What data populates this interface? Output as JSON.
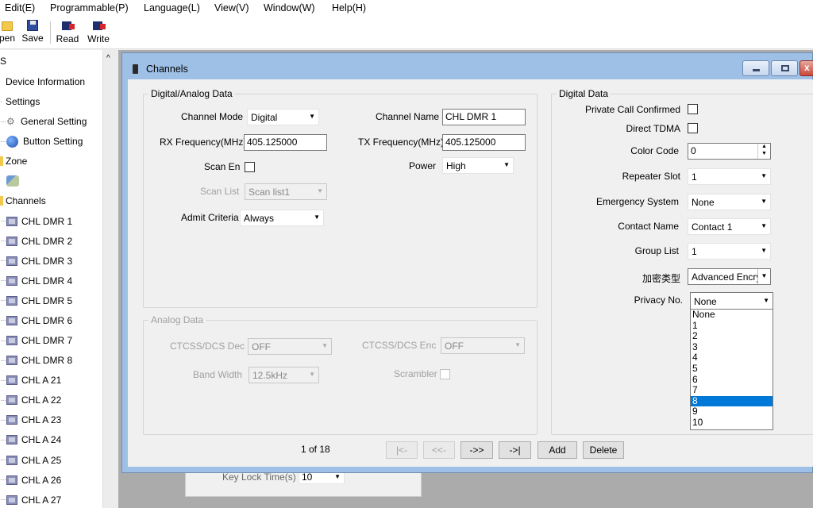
{
  "menu": {
    "items": [
      "Edit(E)",
      "Programmable(P)",
      "Language(L)",
      "View(V)",
      "Window(W)",
      "Help(H)"
    ]
  },
  "toolbar": {
    "open_label": "pen",
    "save_label": "Save",
    "read_label": "Read",
    "write_label": "Write"
  },
  "tree": {
    "header": "S",
    "items": [
      {
        "label": "Device Information",
        "icon": "none"
      },
      {
        "label": "Settings",
        "icon": "expand"
      },
      {
        "label": "General Setting",
        "icon": "gear-icon"
      },
      {
        "label": "Button Setting",
        "icon": "globe-icon"
      },
      {
        "label": "Zone",
        "icon": "folder-icon"
      },
      {
        "label": "",
        "icon": "network-icon"
      },
      {
        "label": "Channels",
        "icon": "folder-icon"
      },
      {
        "label": "CHL DMR 1",
        "icon": "channel-icon"
      },
      {
        "label": "CHL DMR 2",
        "icon": "channel-icon"
      },
      {
        "label": "CHL DMR 3",
        "icon": "channel-icon"
      },
      {
        "label": "CHL DMR 4",
        "icon": "channel-icon"
      },
      {
        "label": "CHL DMR 5",
        "icon": "channel-icon"
      },
      {
        "label": "CHL DMR 6",
        "icon": "channel-icon"
      },
      {
        "label": "CHL DMR 7",
        "icon": "channel-icon"
      },
      {
        "label": "CHL DMR 8",
        "icon": "channel-icon"
      },
      {
        "label": "CHL A 21",
        "icon": "channel-icon"
      },
      {
        "label": "CHL A 22",
        "icon": "channel-icon"
      },
      {
        "label": "CHL A 23",
        "icon": "channel-icon"
      },
      {
        "label": "CHL A 24",
        "icon": "channel-icon"
      },
      {
        "label": "CHL A 25",
        "icon": "channel-icon"
      },
      {
        "label": "CHL A 26",
        "icon": "channel-icon"
      },
      {
        "label": "CHL A 27",
        "icon": "channel-icon"
      }
    ]
  },
  "dialog": {
    "title": "Channels",
    "digital_analog": {
      "legend": "Digital/Analog Data",
      "channel_mode_label": "Channel Mode",
      "channel_mode_value": "Digital",
      "channel_name_label": "Channel Name",
      "channel_name_value": "CHL DMR 1",
      "rx_label": "RX Frequency(MHz)",
      "rx_value": "405.125000",
      "tx_label": "TX Frequency(MHz)",
      "tx_value": "405.125000",
      "scan_en_label": "Scan En",
      "power_label": "Power",
      "power_value": "High",
      "scan_list_label": "Scan List",
      "scan_list_value": "Scan list1",
      "admit_label": "Admit Criteria",
      "admit_value": "Always"
    },
    "analog": {
      "legend": "Analog Data",
      "ctcss_dec_label": "CTCSS/DCS Dec",
      "ctcss_dec_value": "OFF",
      "ctcss_enc_label": "CTCSS/DCS Enc",
      "ctcss_enc_value": "OFF",
      "bandwidth_label": "Band Width",
      "bandwidth_value": "12.5kHz",
      "scrambler_label": "Scrambler"
    },
    "digital": {
      "legend": "Digital Data",
      "private_call_label": "Private Call Confirmed",
      "direct_tdma_label": "Direct TDMA",
      "color_code_label": "Color Code",
      "color_code_value": "0",
      "repeater_slot_label": "Repeater Slot",
      "repeater_slot_value": "1",
      "emergency_label": "Emergency System",
      "emergency_value": "None",
      "contact_label": "Contact Name",
      "contact_value": "Contact 1",
      "group_list_label": "Group List",
      "group_list_value": "1",
      "encrypt_label": "加密类型",
      "encrypt_value": "Advanced Encry",
      "privacy_label": "Privacy No.",
      "privacy_value": "None",
      "privacy_options": [
        "None",
        "1",
        "2",
        "3",
        "4",
        "5",
        "6",
        "7",
        "8",
        "9",
        "10"
      ],
      "privacy_highlighted": "8"
    },
    "nav": {
      "page_text": "1 of 18",
      "first": "|<-",
      "prev": "<<-",
      "next": "->>",
      "last": "->|",
      "add": "Add",
      "delete": "Delete"
    },
    "behind_label": "Key Lock Time(s)",
    "behind_value": "10"
  },
  "colors": {
    "selection": "#0078d7",
    "title_bar": "#9ec0e6",
    "close_button": "#c9483b"
  }
}
